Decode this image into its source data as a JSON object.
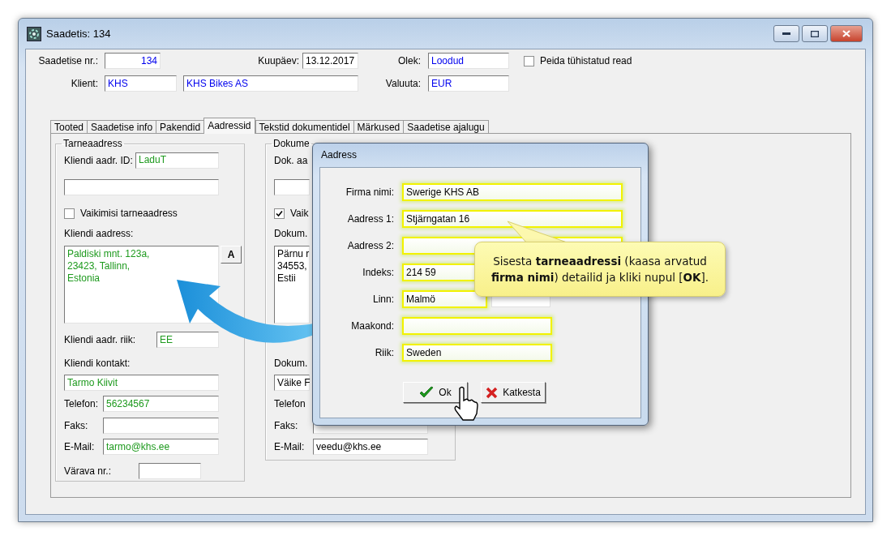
{
  "window": {
    "title": "Saadetis: 134"
  },
  "header": {
    "shipment_no": {
      "label": "Saadetise nr.:",
      "value": "134"
    },
    "date": {
      "label": "Kuupäev:",
      "value": "13.12.2017"
    },
    "status": {
      "label": "Olek:",
      "value": "Loodud"
    },
    "hide_cancelled": {
      "label": "Peida tühistatud read",
      "checked": false
    },
    "client": {
      "label": "Klient:",
      "code": "KHS",
      "name": "KHS Bikes AS"
    },
    "currency": {
      "label": "Valuuta:",
      "value": "EUR"
    }
  },
  "tabs": [
    {
      "label": "Tooted",
      "selected": false
    },
    {
      "label": "Saadetise info",
      "selected": false
    },
    {
      "label": "Pakendid",
      "selected": false
    },
    {
      "label": "Aadressid",
      "selected": true
    },
    {
      "label": "Tekstid dokumentidel",
      "selected": false
    },
    {
      "label": "Märkused",
      "selected": false
    },
    {
      "label": "Saadetise ajalugu",
      "selected": false
    }
  ],
  "delivery_address": {
    "title": "Tarneaadress",
    "address_id": {
      "label": "Kliendi aadr. ID:",
      "value": "LaduT"
    },
    "default_checkbox": {
      "label": "Vaikimisi tarneaadress",
      "checked": false
    },
    "address": {
      "label": "Kliendi aadress:",
      "value": "Paldiski mnt. 123a,\n23423, Tallinn,\nEstonia",
      "button": "A"
    },
    "country": {
      "label": "Kliendi aadr. riik:",
      "value": "EE"
    },
    "contact": {
      "label": "Kliendi kontakt:",
      "value": "Tarmo Kiivit"
    },
    "phone": {
      "label": "Telefon:",
      "value": "56234567"
    },
    "fax": {
      "label": "Faks:"
    },
    "email": {
      "label": "E-Mail:",
      "value": "tarmo@khs.ee"
    },
    "gate": {
      "label": "Värava nr.:"
    }
  },
  "document_address": {
    "title": "Dokume",
    "address_id": {
      "label": "Dok. aa"
    },
    "default_checkbox": {
      "label": "Vaik",
      "checked": true
    },
    "address": {
      "label": "Dokum.",
      "value": "Pärnu r\n34553,\nEstii"
    },
    "contact": {
      "label": "Dokum.",
      "value": "Väike F"
    },
    "phone": {
      "label": "Telefon"
    },
    "fax": {
      "label": "Faks:"
    },
    "email": {
      "label": "E-Mail:",
      "value": "veedu@khs.ee"
    }
  },
  "dialog": {
    "title": "Aadress",
    "fields": [
      {
        "label": "Firma nimi:",
        "value": "Swerige KHS AB",
        "kind": "wide"
      },
      {
        "label": "Aadress 1:",
        "value": "Stjärngatan 16",
        "kind": "wide"
      },
      {
        "label": "Aadress 2:",
        "kind": "wide"
      },
      {
        "label": "Indeks:",
        "value": "214 59",
        "kind": "medium"
      },
      {
        "label": "Linn:",
        "value": "Malmö",
        "kind": "split"
      },
      {
        "label": "Maakond:",
        "kind": "medium"
      },
      {
        "label": "Riik:",
        "value": "Sweden",
        "kind": "medium"
      }
    ],
    "buttons": [
      {
        "label": "Ok",
        "kind": "ok"
      },
      {
        "label": "Katkesta",
        "kind": "cancel"
      }
    ]
  },
  "callout": {
    "text": "Sisesta **tarneaadressi** (kaasa arvatud **firma nimi**) detailid ja kliki nupul [**OK**]."
  }
}
